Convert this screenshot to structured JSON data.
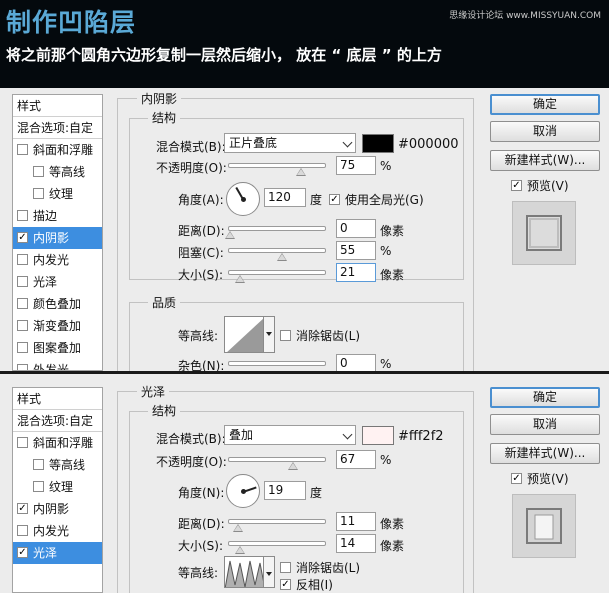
{
  "banner": {
    "title": "制作凹陷层",
    "subtitle": "将之前那个圆角六边形复制一层然后缩小， 放在 “ 底层 ” 的上方",
    "watermark": "思缘设计论坛 www.MISSYUAN.COM"
  },
  "panel1": {
    "style_list": {
      "header": "样式",
      "blend_options": "混合选项:自定",
      "items": [
        {
          "label": "斜面和浮雕",
          "checked": false
        },
        {
          "label": "等高线",
          "checked": false
        },
        {
          "label": "纹理",
          "checked": false
        },
        {
          "label": "描边",
          "checked": false
        },
        {
          "label": "内阴影",
          "checked": true
        },
        {
          "label": "内发光",
          "checked": false
        },
        {
          "label": "光泽",
          "checked": false
        },
        {
          "label": "颜色叠加",
          "checked": false
        },
        {
          "label": "渐变叠加",
          "checked": false
        },
        {
          "label": "图案叠加",
          "checked": false
        },
        {
          "label": "外发光",
          "checked": false
        }
      ]
    },
    "section_title": "内阴影",
    "structure_title": "结构",
    "blend_mode_label": "混合模式(B):",
    "blend_mode_value": "正片叠底",
    "color_hex": "#000000",
    "color": "#000000",
    "opacity_label": "不透明度(O):",
    "opacity_value": "75",
    "percent": "%",
    "angle_label": "角度(A):",
    "angle_value": "120",
    "angle_unit": "度",
    "global_light_label": "使用全局光(G)",
    "global_light_checked": true,
    "distance_label": "距离(D):",
    "distance_value": "0",
    "choke_label": "阻塞(C):",
    "choke_value": "55",
    "size_label": "大小(S):",
    "size_value": "21",
    "px_unit": "像素",
    "quality_title": "品质",
    "contour_label": "等高线:",
    "antialias_label": "消除锯齿(L)",
    "antialias_checked": false,
    "noise_label": "杂色(N):",
    "noise_value": "0",
    "buttons": {
      "ok": "确定",
      "cancel": "取消",
      "new_style": "新建样式(W)...",
      "preview": "预览(V)"
    },
    "preview_checked": true
  },
  "panel2": {
    "style_list": {
      "header": "样式",
      "blend_options": "混合选项:自定",
      "items": [
        {
          "label": "斜面和浮雕",
          "checked": false
        },
        {
          "label": "等高线",
          "checked": false
        },
        {
          "label": "纹理",
          "checked": false
        },
        {
          "label": "内阴影",
          "checked": true
        },
        {
          "label": "内发光",
          "checked": false
        },
        {
          "label": "光泽",
          "checked": true
        }
      ]
    },
    "section_title": "光泽",
    "structure_title": "结构",
    "blend_mode_label": "混合模式(B):",
    "blend_mode_value": "叠加",
    "color_hex": "#fff2f2",
    "color": "#fff2f2",
    "opacity_label": "不透明度(O):",
    "opacity_value": "67",
    "percent": "%",
    "angle_label": "角度(N):",
    "angle_value": "19",
    "angle_unit": "度",
    "distance_label": "距离(D):",
    "distance_value": "11",
    "size_label": "大小(S):",
    "size_value": "14",
    "px_unit": "像素",
    "contour_label": "等高线:",
    "antialias_label": "消除锯齿(L)",
    "antialias_checked": false,
    "invert_label": "反相(I)",
    "invert_checked": true,
    "buttons": {
      "ok": "确定",
      "cancel": "取消",
      "new_style": "新建样式(W)...",
      "preview": "预览(V)"
    },
    "preview_checked": true
  }
}
